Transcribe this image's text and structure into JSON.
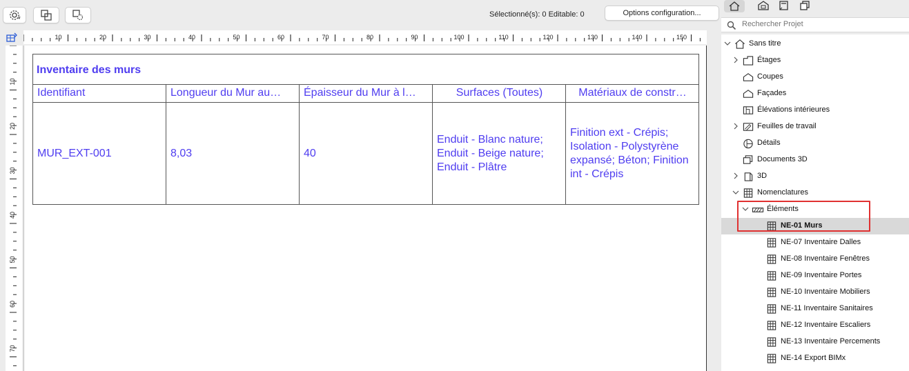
{
  "toolbar": {
    "selection_status": "Sélectionné(s): 0  Editable: 0",
    "options_label": "Options configuration..."
  },
  "ruler": {
    "horizontal_labels": [
      "10",
      "20",
      "30",
      "40",
      "50",
      "60",
      "70",
      "80",
      "90",
      "100",
      "110",
      "120",
      "130",
      "140",
      "150"
    ],
    "vertical_labels": [
      "10",
      "20",
      "30",
      "40",
      "50",
      "60",
      "70"
    ]
  },
  "schedule": {
    "title": "Inventaire des murs",
    "columns": [
      "Identifiant",
      "Longueur du Mur au…",
      "Épaisseur du Mur à l…",
      "Surfaces (Toutes)",
      "Matériaux de constr…"
    ],
    "rows": [
      {
        "id": "MUR_EXT-001",
        "length": "8,03",
        "thickness": "40",
        "surfaces": "Enduit - Blanc nature; Enduit - Beige nature; Enduit - Plâtre",
        "materials": "Finition ext - Crépis; Isolation - Polystyrène expansé; Béton; Finition int - Crépis"
      }
    ]
  },
  "sidebar": {
    "search_placeholder": "Rechercher Projet",
    "tree": [
      {
        "label": "Sans titre",
        "icon": "house-icon",
        "level": 0,
        "chevron": "down"
      },
      {
        "label": "Étages",
        "icon": "floors-icon",
        "level": 1,
        "chevron": "right"
      },
      {
        "label": "Coupes",
        "icon": "section-icon",
        "level": 1,
        "chevron": ""
      },
      {
        "label": "Façades",
        "icon": "elevation-icon",
        "level": 1,
        "chevron": ""
      },
      {
        "label": "Élévations intérieures",
        "icon": "interior-elevation-icon",
        "level": 1,
        "chevron": ""
      },
      {
        "label": "Feuilles de travail",
        "icon": "worksheet-icon",
        "level": 1,
        "chevron": "right"
      },
      {
        "label": "Détails",
        "icon": "detail-icon",
        "level": 1,
        "chevron": ""
      },
      {
        "label": "Documents 3D",
        "icon": "document-3d-icon",
        "level": 1,
        "chevron": ""
      },
      {
        "label": "3D",
        "icon": "cube-icon",
        "level": 1,
        "chevron": "right"
      },
      {
        "label": "Nomenclatures",
        "icon": "schedule-icon",
        "level": 1,
        "chevron": "down"
      },
      {
        "label": "Éléments",
        "icon": "wall-hatch-icon",
        "level": 2,
        "chevron": "down"
      },
      {
        "label": "NE-01 Murs",
        "icon": "schedule-icon",
        "level": 3,
        "chevron": "",
        "selected": true
      },
      {
        "label": "NE-07 Inventaire Dalles",
        "icon": "schedule-icon",
        "level": 3,
        "chevron": ""
      },
      {
        "label": "NE-08 Inventaire Fenêtres",
        "icon": "schedule-icon",
        "level": 3,
        "chevron": ""
      },
      {
        "label": "NE-09 Inventaire Portes",
        "icon": "schedule-icon",
        "level": 3,
        "chevron": ""
      },
      {
        "label": "NE-10 Inventaire Mobiliers",
        "icon": "schedule-icon",
        "level": 3,
        "chevron": ""
      },
      {
        "label": "NE-11 Inventaire Sanitaires",
        "icon": "schedule-icon",
        "level": 3,
        "chevron": ""
      },
      {
        "label": "NE-12 Inventaire Escaliers",
        "icon": "schedule-icon",
        "level": 3,
        "chevron": ""
      },
      {
        "label": "NE-13 Inventaire Percements",
        "icon": "schedule-icon",
        "level": 3,
        "chevron": ""
      },
      {
        "label": "NE-14 Export BIMx",
        "icon": "schedule-icon",
        "level": 3,
        "chevron": ""
      }
    ]
  },
  "colors": {
    "schedule_text": "#4f3df0",
    "highlight_box": "#e03030",
    "selected_row": "#d9d9d9"
  }
}
